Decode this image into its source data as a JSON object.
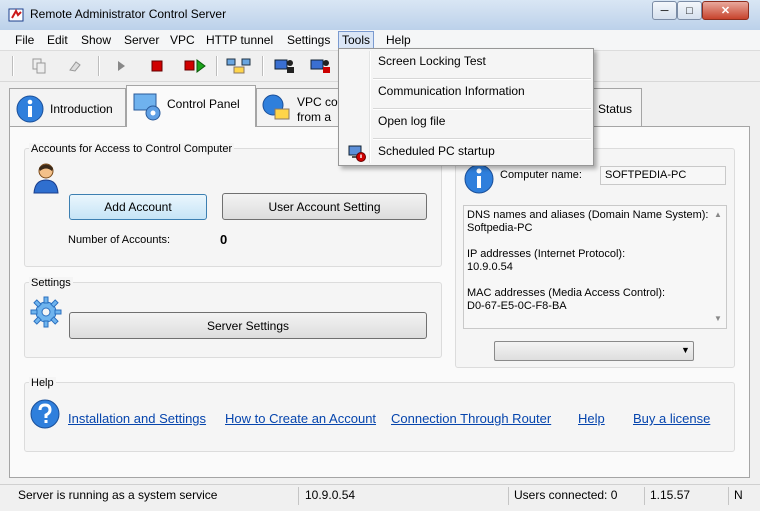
{
  "window": {
    "title": "Remote Administrator Control Server",
    "minimize": "─",
    "maximize": "□",
    "close": "✕"
  },
  "menu": [
    "File",
    "Edit",
    "Show",
    "Server",
    "VPC",
    "HTTP tunnel",
    "Settings",
    "Tools",
    "Help"
  ],
  "tabs": {
    "introduction": "Introduction",
    "control_panel": "Control Panel",
    "vpc_line1": "VPC co",
    "vpc_line2": "from a",
    "status": "Status"
  },
  "accounts": {
    "title": "Accounts for Access to Control Computer",
    "add_account": "Add Account",
    "user_account_setting": "User Account Setting",
    "number_label": "Number of Accounts:",
    "number_value": "0"
  },
  "settings": {
    "title": "Settings",
    "server_settings": "Server Settings"
  },
  "computer": {
    "name_label": "Computer name:",
    "name_value": "SOFTPEDIA-PC",
    "dns_label": "DNS names and aliases (Domain Name System):",
    "dns_value": "Softpedia-PC",
    "ip_label": "IP addresses (Internet Protocol):",
    "ip_value": "10.9.0.54",
    "mac_label": "MAC addresses (Media Access Control):",
    "mac_value": "D0-67-E5-0C-F8-BA"
  },
  "help": {
    "title": "Help",
    "links": [
      "Installation and Settings",
      "How to Create an Account",
      "Connection Through Router",
      "Help",
      "Buy a license"
    ]
  },
  "statusbar": {
    "message": "Server is running as a system service",
    "ip": "10.9.0.54",
    "users": "Users connected: 0",
    "version": "1.15.57",
    "last": "N"
  },
  "tools_menu": [
    "Screen Locking Test",
    "Communication Information",
    "Open log file",
    "Scheduled PC startup"
  ],
  "colors": {
    "accent": "#3c7fb1",
    "link": "#0645ad",
    "title_bar": "#bcd1ea"
  }
}
